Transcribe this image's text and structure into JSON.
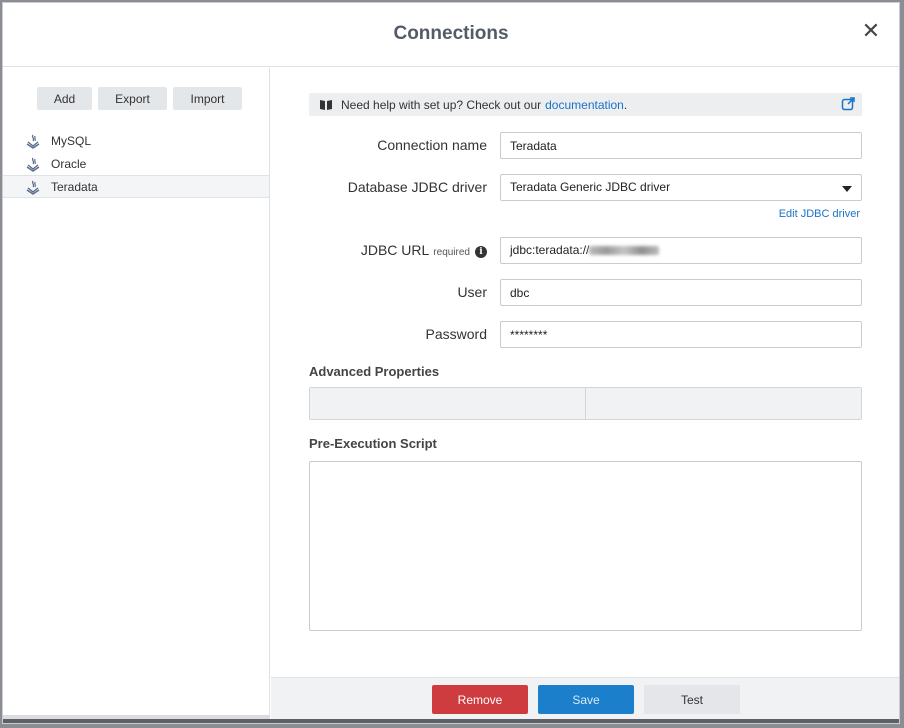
{
  "dialog": {
    "title": "Connections",
    "close_glyph": "✕"
  },
  "toolbar": {
    "add_label": "Add",
    "export_label": "Export",
    "import_label": "Import"
  },
  "connections": [
    {
      "name": "MySQL",
      "icon": "database-icon"
    },
    {
      "name": "Oracle",
      "icon": "database-icon"
    },
    {
      "name": "Teradata",
      "icon": "database-icon",
      "selected": true
    }
  ],
  "help": {
    "text": "Need help with set up? Check out our",
    "link": "documentation",
    "suffix": "."
  },
  "form": {
    "connection_name_label": "Connection name",
    "connection_name_value": "Teradata",
    "driver_label": "Database JDBC driver",
    "driver_value": "Teradata Generic JDBC driver",
    "edit_driver_link": "Edit JDBC driver",
    "jdbc_url_label": "JDBC URL",
    "jdbc_url_required": "required",
    "jdbc_url_prefix": "jdbc:teradata://",
    "user_label": "User",
    "user_value": "dbc",
    "password_label": "Password",
    "password_value": "********",
    "advanced_title": "Advanced Properties",
    "script_title": "Pre-Execution Script"
  },
  "footer": {
    "remove_label": "Remove",
    "save_label": "Save",
    "test_label": "Test"
  },
  "colors": {
    "accent": "#1b7fcc",
    "danger": "#cf3c40",
    "link": "#1a73c6"
  }
}
